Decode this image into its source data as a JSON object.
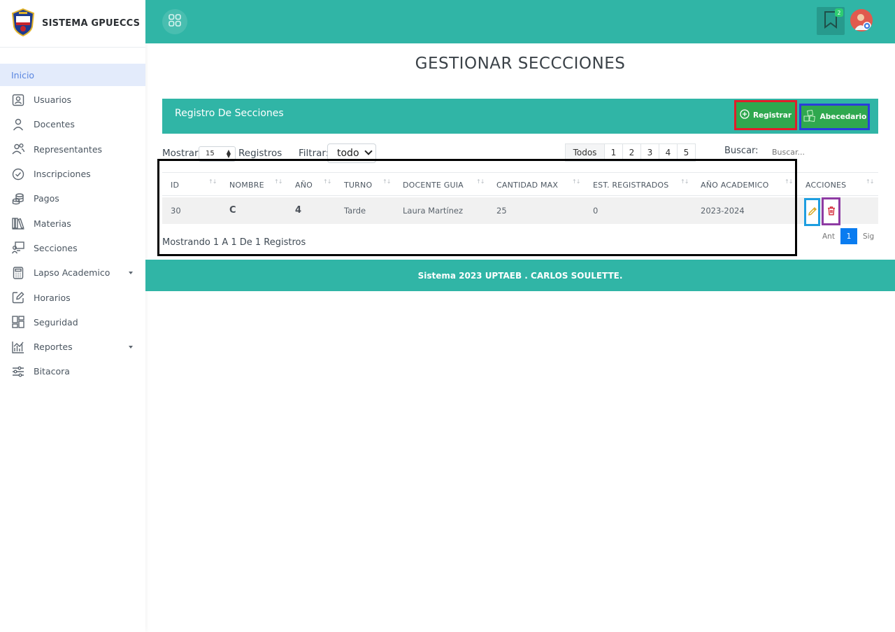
{
  "brand": {
    "name": "SISTEMA GPUECCS",
    "logo_icon": "school-shield-logo"
  },
  "sidebar": {
    "items": [
      {
        "label": "Inicio",
        "icon": "none",
        "active": true
      },
      {
        "label": "Usuarios",
        "icon": "user-badge-icon"
      },
      {
        "label": "Docentes",
        "icon": "person-icon"
      },
      {
        "label": "Representantes",
        "icon": "people-icon"
      },
      {
        "label": "Inscripciones",
        "icon": "check-circle-icon"
      },
      {
        "label": "Pagos",
        "icon": "coins-icon"
      },
      {
        "label": "Materias",
        "icon": "books-icon"
      },
      {
        "label": "Secciones",
        "icon": "classroom-icon"
      },
      {
        "label": "Lapso Academico",
        "icon": "calculator-icon",
        "has_submenu": true
      },
      {
        "label": "Horarios",
        "icon": "edit-icon"
      },
      {
        "label": "Seguridad",
        "icon": "layout-icon"
      },
      {
        "label": "Reportes",
        "icon": "chart-icon",
        "has_submenu": true
      },
      {
        "label": "Bitacora",
        "icon": "sliders-icon"
      }
    ]
  },
  "topbar": {
    "notification_count": "2"
  },
  "page": {
    "title": "GESTIONAR SECCCIONES"
  },
  "card": {
    "title": "Registro De Secciones",
    "register_label": "Registrar",
    "alphabet_label": "Abecedario"
  },
  "controls": {
    "show_label": "Mostrar",
    "show_value": "15",
    "records_label": "Registros",
    "filter_label": "Filtrar:",
    "filter_value": "todo",
    "pages": [
      "Todos",
      "1",
      "2",
      "3",
      "4",
      "5"
    ],
    "search_label": "Buscar:",
    "search_placeholder": "Buscar..."
  },
  "table": {
    "columns": [
      "ID",
      "NOMBRE",
      "AÑO",
      "TURNO",
      "DOCENTE GUIA",
      "CANTIDAD MAX",
      "EST. REGISTRADOS",
      "AÑO ACADEMICO",
      "ACCIONES"
    ],
    "rows": [
      [
        "30",
        "C",
        "4",
        "Tarde",
        "Laura Martínez",
        "25",
        "0",
        "2023-2024"
      ]
    ]
  },
  "info": "Mostrando 1 A 1 De 1 Registros",
  "pager": {
    "prev": "Ant",
    "current": "1",
    "next": "Sig"
  },
  "footer": "Sistema 2023 UPTAEB . CARLOS SOULETTE.",
  "colors": {
    "teal": "#30b5a6",
    "green_button": "#2fa84f",
    "active_page": "#0a7cf0"
  }
}
